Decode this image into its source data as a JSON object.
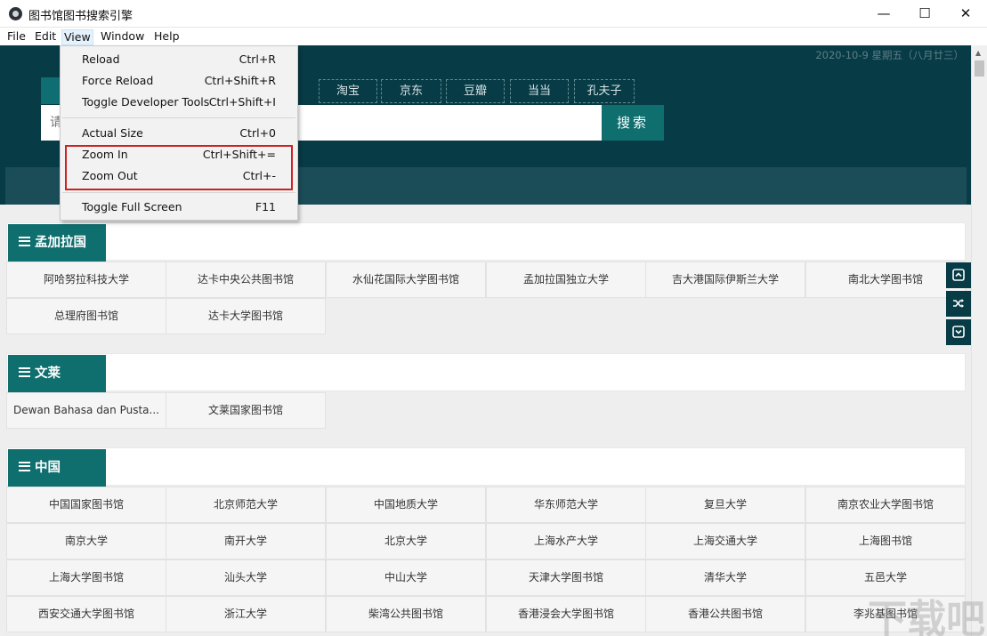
{
  "window": {
    "title": "图书馆图书搜索引擎",
    "min": "—",
    "max": "☐",
    "close": "✕"
  },
  "menubar": {
    "items": [
      "File",
      "Edit",
      "View",
      "Window",
      "Help"
    ]
  },
  "header": {
    "date": "2020-10-9 星期五（八月廿三）",
    "tabs": [
      "淘宝",
      "京东",
      "豆瓣",
      "当当",
      "孔夫子"
    ],
    "search_placeholder": "请",
    "search_button": "搜索"
  },
  "view_menu": {
    "items": [
      {
        "label": "Reload",
        "accel": "Ctrl+R"
      },
      {
        "label": "Force Reload",
        "accel": "Ctrl+Shift+R"
      },
      {
        "label": "Toggle Developer Tools",
        "accel": "Ctrl+Shift+I"
      },
      {
        "label": "Actual Size",
        "accel": "Ctrl+0"
      },
      {
        "label": "Zoom In",
        "accel": "Ctrl+Shift+="
      },
      {
        "label": "Zoom Out",
        "accel": "Ctrl+-"
      },
      {
        "label": "Toggle Full Screen",
        "accel": "F11"
      }
    ]
  },
  "sections": [
    {
      "title": "孟加拉国",
      "libraries": [
        "阿哈努拉科技大学",
        "达卡中央公共图书馆",
        "水仙花国际大学图书馆",
        "孟加拉国独立大学",
        "吉大港国际伊斯兰大学",
        "南北大学图书馆",
        "总理府图书馆",
        "达卡大学图书馆"
      ]
    },
    {
      "title": "文莱",
      "libraries": [
        "Dewan Bahasa dan Pusta...",
        "文莱国家图书馆"
      ]
    },
    {
      "title": "中国",
      "libraries": [
        "中国国家图书馆",
        "北京师范大学",
        "中国地质大学",
        "华东师范大学",
        "复旦大学",
        "南京农业大学图书馆",
        "南京大学",
        "南开大学",
        "北京大学",
        "上海水产大学",
        "上海交通大学",
        "上海图书馆",
        "上海大学图书馆",
        "汕头大学",
        "中山大学",
        "天津大学图书馆",
        "清华大学",
        "五邑大学",
        "西安交通大学图书馆",
        "浙江大学",
        "柴湾公共图书馆",
        "香港浸会大学图书馆",
        "香港公共图书馆",
        "李兆基图书馆"
      ]
    }
  ],
  "side_buttons": [
    "top-icon",
    "shuffle-icon",
    "bottom-icon"
  ],
  "watermark": "下载吧",
  "colors": {
    "header_bg": "#073b46",
    "accent": "#0f6e6e",
    "highlight": "#cc2222"
  }
}
